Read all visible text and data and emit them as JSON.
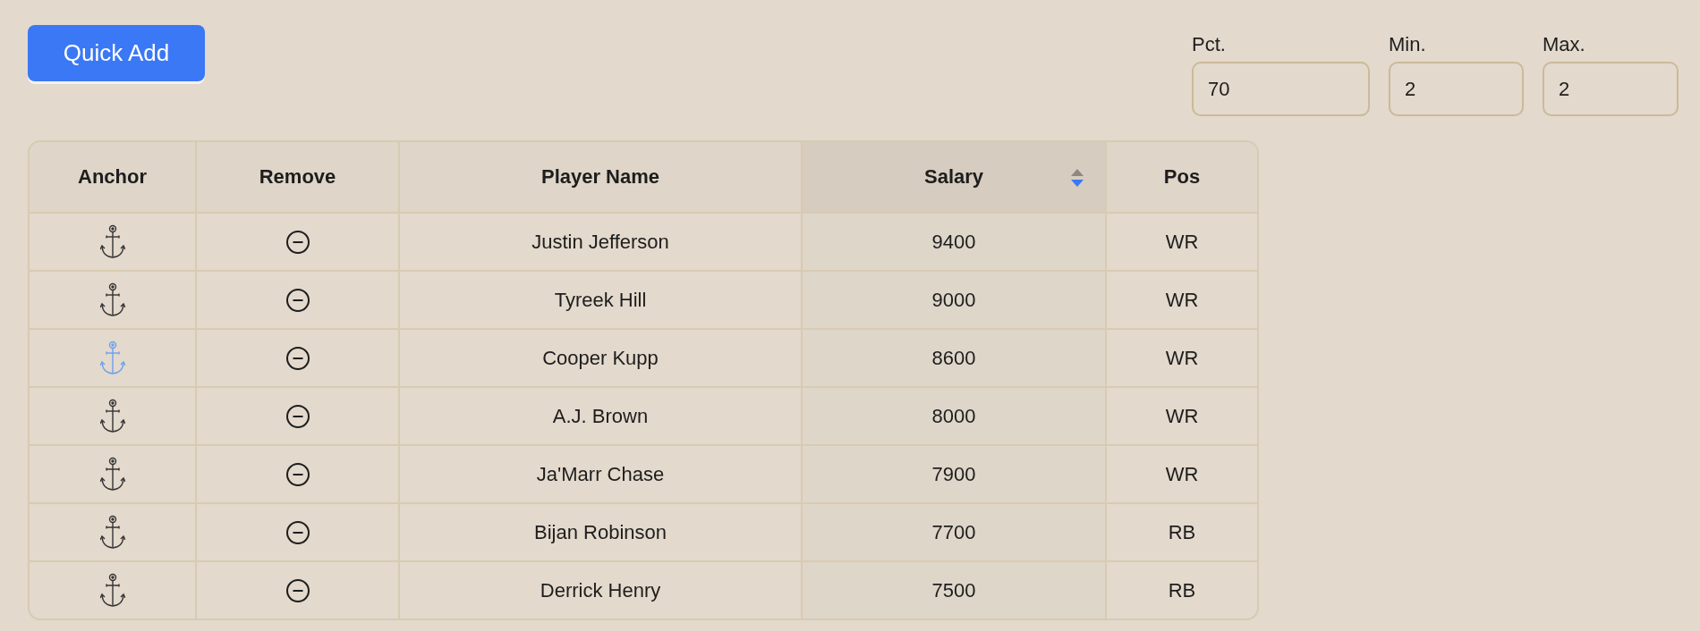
{
  "quick_add_button": {
    "label": "Quick Add"
  },
  "fields": [
    {
      "label": "Pct.",
      "value": "70"
    },
    {
      "label": "Min.",
      "value": "2"
    },
    {
      "label": "Max.",
      "value": "2"
    }
  ],
  "table": {
    "columns": [
      {
        "label": "Anchor",
        "sorted": false
      },
      {
        "label": "Remove",
        "sorted": false
      },
      {
        "label": "Player Name",
        "sorted": false
      },
      {
        "label": "Salary",
        "sorted": true,
        "descending": true
      },
      {
        "label": "Pos",
        "sorted": false
      }
    ],
    "rows": [
      {
        "anchored": false,
        "name": "Justin Jefferson",
        "salary": "9400",
        "pos": "WR"
      },
      {
        "anchored": false,
        "name": "Tyreek Hill",
        "salary": "9000",
        "pos": "WR"
      },
      {
        "anchored": true,
        "name": "Cooper Kupp",
        "salary": "8600",
        "pos": "WR"
      },
      {
        "anchored": false,
        "name": "A.J. Brown",
        "salary": "8000",
        "pos": "WR"
      },
      {
        "anchored": false,
        "name": "Ja'Marr Chase",
        "salary": "7900",
        "pos": "WR"
      },
      {
        "anchored": false,
        "name": "Bijan Robinson",
        "salary": "7700",
        "pos": "RB"
      },
      {
        "anchored": false,
        "name": "Derrick Henry",
        "salary": "7500",
        "pos": "RB"
      }
    ]
  }
}
